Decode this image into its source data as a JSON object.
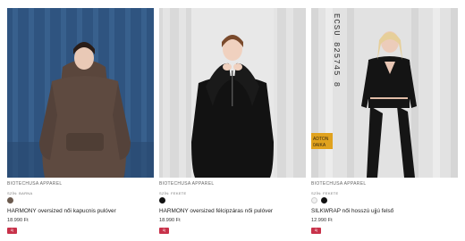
{
  "products": [
    {
      "brand": "BIOTECHUSA APPAREL",
      "color_label": "SZÍN: BARNA",
      "swatches": [
        "#6b5a4e"
      ],
      "name": "HARMONY oversized női kapucnis pulóver",
      "price": "18.990 Ft",
      "badge": "Új"
    },
    {
      "brand": "BIOTECHUSA APPAREL",
      "color_label": "SZÍN: FEKETE",
      "swatches": [
        "#111111"
      ],
      "name": "HARMONY oversized félcipzáras női pulóver",
      "price": "18.990 Ft",
      "badge": "Új"
    },
    {
      "brand": "BIOTECHUSA APPAREL",
      "color_label": "SZÍN: FEKETE",
      "swatches": [
        "#f1f1f1",
        "#111111"
      ],
      "name": "SILKWRAP női hosszú ujjú felső",
      "price": "12.990 Ft",
      "badge": "Új"
    }
  ],
  "photos": {
    "p1": {
      "background": "#3a5f8a",
      "garment": "#5e4a40"
    },
    "p2": {
      "background": "#dcdcdc",
      "garment": "#121212"
    },
    "p3": {
      "background": "#e3e3e3",
      "garment": "#141414",
      "container_text": "ECSU 825745 8",
      "sticker_text": "ADTON 0AIKA"
    }
  }
}
